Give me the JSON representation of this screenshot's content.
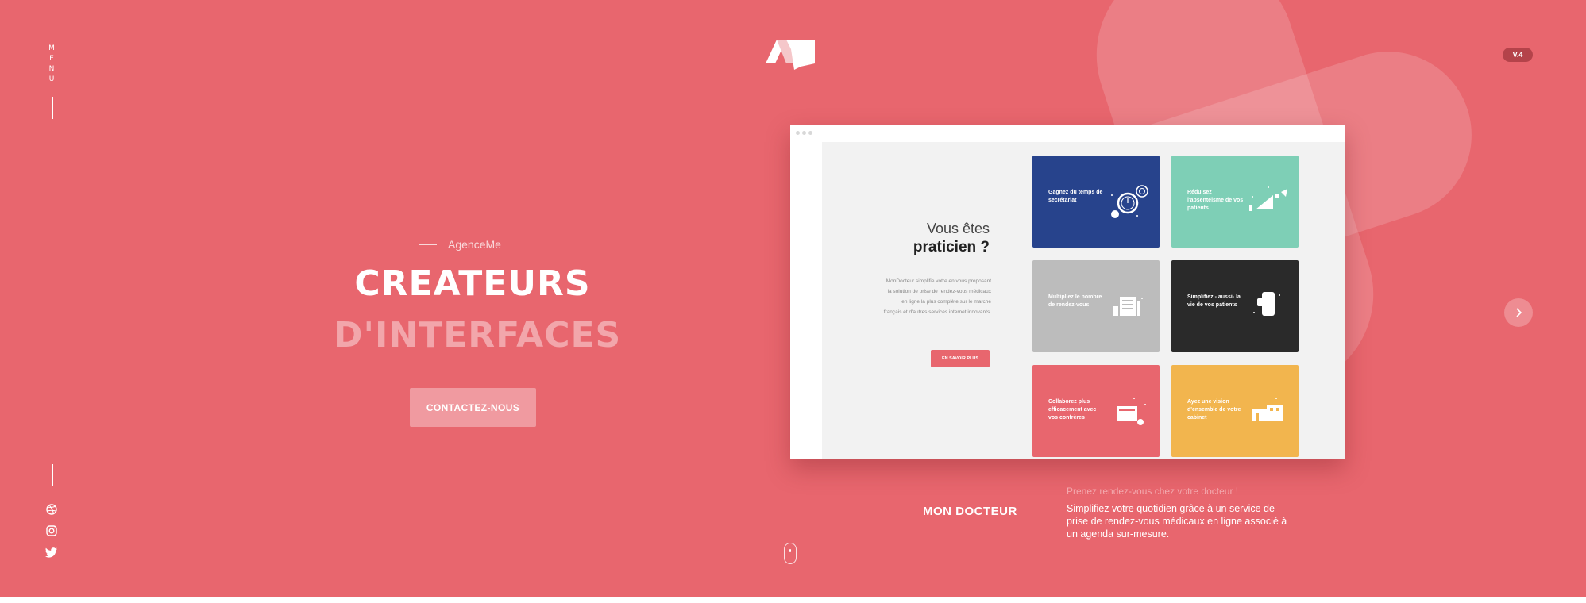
{
  "nav": {
    "menu_label": "MENU",
    "version_label": "V.4"
  },
  "social": {
    "icons": [
      "dribbble-icon",
      "instagram-icon",
      "twitter-icon"
    ]
  },
  "hero": {
    "eyebrow": "AgenceMe",
    "title_line1": "CREATEURS",
    "title_line2": "D'INTERFACES",
    "cta_label": "CONTACTEZ-NOUS"
  },
  "showcase": {
    "heading_light": "Vous êtes",
    "heading_bold": "praticien ?",
    "paragraph": "MonDocteur simplifie votre en vous proposant la solution de prise de rendez-vous médicaux en ligne la plus complète sur le marché français et d'autres services internet innovants.",
    "button_label": "EN SAVOIR PLUS",
    "tiles": [
      {
        "label": "Gagnez du temps de secrétariat",
        "color": "#27438c"
      },
      {
        "label": "Réduisez l'absentéisme de vos patients",
        "color": "#7ecfb6"
      },
      {
        "label": "Multipliez le nombre de rendez-vous",
        "color": "#bcbcbc"
      },
      {
        "label": "Simplifiez - aussi- la vie de vos patients",
        "color": "#2a2a2a"
      },
      {
        "label": "Collaborez plus efficacement avec vos confrères",
        "color": "#e8666e"
      },
      {
        "label": "Ayez une vision d'ensemble de votre cabinet",
        "color": "#f2b54e"
      }
    ]
  },
  "project": {
    "title": "MON DOCTEUR",
    "subtitle": "Prenez rendez-vous chez votre docteur !",
    "description": "Simplifiez votre quotidien grâce à un service de prise de rendez-vous médicaux en ligne associé à un agenda sur-mesure."
  },
  "colors": {
    "background": "#e8666e",
    "cta": "#f09aa0",
    "title_secondary": "#f2a6ab"
  }
}
